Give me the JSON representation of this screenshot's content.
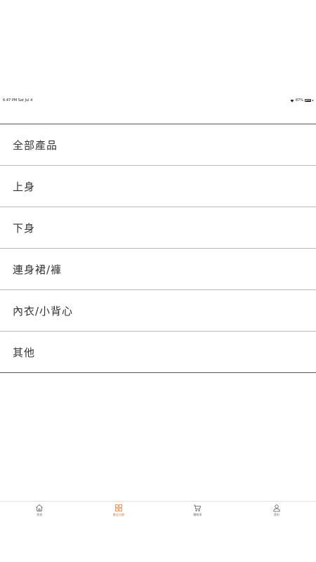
{
  "status_bar": {
    "time": "6:47 PM  Sat Jul 4",
    "battery": "87%",
    "battery_level": 0.87
  },
  "categories": [
    {
      "label": "全部產品"
    },
    {
      "label": "上身"
    },
    {
      "label": "下身"
    },
    {
      "label": "連身裙/褲"
    },
    {
      "label": "內衣/小背心"
    },
    {
      "label": "其他"
    }
  ],
  "tab_bar": {
    "accent_color": "#e07a3a",
    "tabs": [
      {
        "label": "首頁",
        "icon": "home-icon",
        "active": false
      },
      {
        "label": "產品分類",
        "icon": "grid-icon",
        "active": true
      },
      {
        "label": "購物車",
        "icon": "cart-icon",
        "active": false
      },
      {
        "label": "我的",
        "icon": "user-icon",
        "active": false
      }
    ]
  }
}
